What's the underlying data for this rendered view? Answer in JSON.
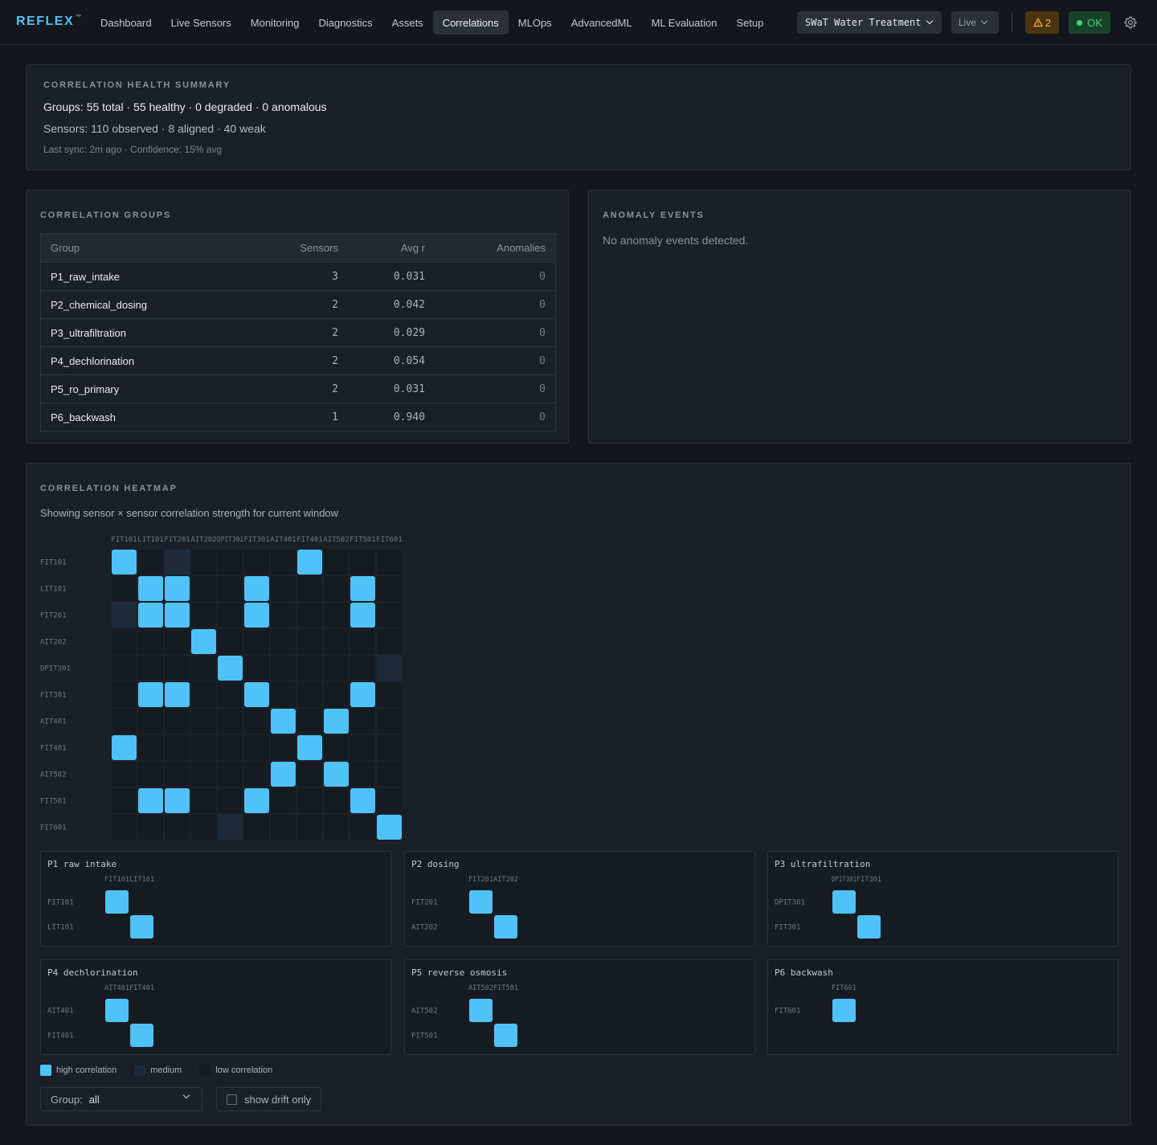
{
  "app": {
    "logo": "REFLEX",
    "logo_mark": "™"
  },
  "nav": [
    {
      "label": "Dashboard",
      "active": false
    },
    {
      "label": "Live Sensors",
      "active": false
    },
    {
      "label": "Monitoring",
      "active": false
    },
    {
      "label": "Diagnostics",
      "active": false
    },
    {
      "label": "Assets",
      "active": false
    },
    {
      "label": "Correlations",
      "active": true
    },
    {
      "label": "MLOps",
      "active": false
    },
    {
      "label": "AdvancedML",
      "active": false
    },
    {
      "label": "ML Evaluation",
      "active": false
    },
    {
      "label": "Setup",
      "active": false
    }
  ],
  "header": {
    "site": "SWaT Water Treatment",
    "mode": "Live",
    "warning_count": "2",
    "status": "OK",
    "warn_color": "#f5b340",
    "ok_color": "#4cd07d"
  },
  "summary": {
    "title": "CORRELATION HEALTH SUMMARY",
    "groups_line": "Groups: 55 total · 55 healthy · 0 degraded · 0 anomalous",
    "sensors_line": "Sensors: 110 observed · 8 aligned · 40 weak",
    "sync_line": "Last sync: 2m ago · Confidence: 15% avg"
  },
  "groups": {
    "title": "CORRELATION GROUPS",
    "columns": [
      "Group",
      "Sensors",
      "Avg r",
      "Anomalies"
    ],
    "rows": [
      {
        "group": "P1_raw_intake",
        "sensors": "3",
        "avg_r": "0.031",
        "anomalies": "0"
      },
      {
        "group": "P2_chemical_dosing",
        "sensors": "2",
        "avg_r": "0.042",
        "anomalies": "0"
      },
      {
        "group": "P3_ultrafiltration",
        "sensors": "2",
        "avg_r": "0.029",
        "anomalies": "0"
      },
      {
        "group": "P4_dechlorination",
        "sensors": "2",
        "avg_r": "0.054",
        "anomalies": "0"
      },
      {
        "group": "P5_ro_primary",
        "sensors": "2",
        "avg_r": "0.031",
        "anomalies": "0"
      },
      {
        "group": "P6_backwash",
        "sensors": "1",
        "avg_r": "0.940",
        "anomalies": "0"
      }
    ]
  },
  "anomalies": {
    "title": "ANOMALY EVENTS",
    "empty_text": "No anomaly events detected."
  },
  "heatmap": {
    "title": "CORRELATION HEATMAP",
    "subtitle": "Showing sensor × sensor correlation strength for current window",
    "colors": {
      "high": "#4fc3f7",
      "medium": "#1c2a3a",
      "low": "#161a21",
      "grid": "#22272f"
    },
    "legend": {
      "high": "high correlation",
      "medium": "medium",
      "low": "low correlation"
    },
    "controls": {
      "group_label": "Group:",
      "group_value": "all",
      "drift_label": "show drift only",
      "drift_checked": false
    }
  },
  "chart_data": [
    {
      "type": "heatmap",
      "title": "",
      "sensors": [
        "FIT101",
        "LIT101",
        "FIT201",
        "AIT202",
        "DPIT301",
        "FIT301",
        "AIT401",
        "FIT401",
        "AIT502",
        "FIT501",
        "FIT601"
      ],
      "levels": [
        [
          2,
          0,
          1,
          0,
          0,
          0,
          0,
          2,
          0,
          0,
          0
        ],
        [
          0,
          2,
          2,
          0,
          0,
          2,
          0,
          0,
          0,
          2,
          0
        ],
        [
          1,
          2,
          2,
          0,
          0,
          2,
          0,
          0,
          0,
          2,
          0
        ],
        [
          0,
          0,
          0,
          2,
          0,
          0,
          0,
          0,
          0,
          0,
          0
        ],
        [
          0,
          0,
          0,
          0,
          2,
          0,
          0,
          0,
          0,
          0,
          1
        ],
        [
          0,
          2,
          2,
          0,
          0,
          2,
          0,
          0,
          0,
          2,
          0
        ],
        [
          0,
          0,
          0,
          0,
          0,
          0,
          2,
          0,
          2,
          0,
          0
        ],
        [
          2,
          0,
          0,
          0,
          0,
          0,
          0,
          2,
          0,
          0,
          0
        ],
        [
          0,
          0,
          0,
          0,
          0,
          0,
          2,
          0,
          2,
          0,
          0
        ],
        [
          0,
          2,
          2,
          0,
          0,
          2,
          0,
          0,
          0,
          2,
          0
        ],
        [
          0,
          0,
          0,
          0,
          1,
          0,
          0,
          0,
          0,
          0,
          2
        ]
      ]
    },
    {
      "type": "heatmap",
      "title": "P1 raw intake",
      "sensors": [
        "FIT101",
        "LIT101"
      ],
      "levels": [
        [
          2,
          0
        ],
        [
          0,
          2
        ]
      ]
    },
    {
      "type": "heatmap",
      "title": "P2 dosing",
      "sensors": [
        "FIT201",
        "AIT202"
      ],
      "levels": [
        [
          2,
          0
        ],
        [
          0,
          2
        ]
      ]
    },
    {
      "type": "heatmap",
      "title": "P3 ultrafiltration",
      "sensors": [
        "DPIT301",
        "FIT301"
      ],
      "levels": [
        [
          2,
          0
        ],
        [
          0,
          2
        ]
      ]
    },
    {
      "type": "heatmap",
      "title": "P4 dechlorination",
      "sensors": [
        "AIT401",
        "FIT401"
      ],
      "levels": [
        [
          2,
          0
        ],
        [
          0,
          2
        ]
      ]
    },
    {
      "type": "heatmap",
      "title": "P5 reverse osmosis",
      "sensors": [
        "AIT502",
        "FIT501"
      ],
      "levels": [
        [
          2,
          0
        ],
        [
          0,
          2
        ]
      ]
    },
    {
      "type": "heatmap",
      "title": "P6 backwash",
      "sensors": [
        "FIT601"
      ],
      "levels": [
        [
          2
        ]
      ]
    }
  ]
}
